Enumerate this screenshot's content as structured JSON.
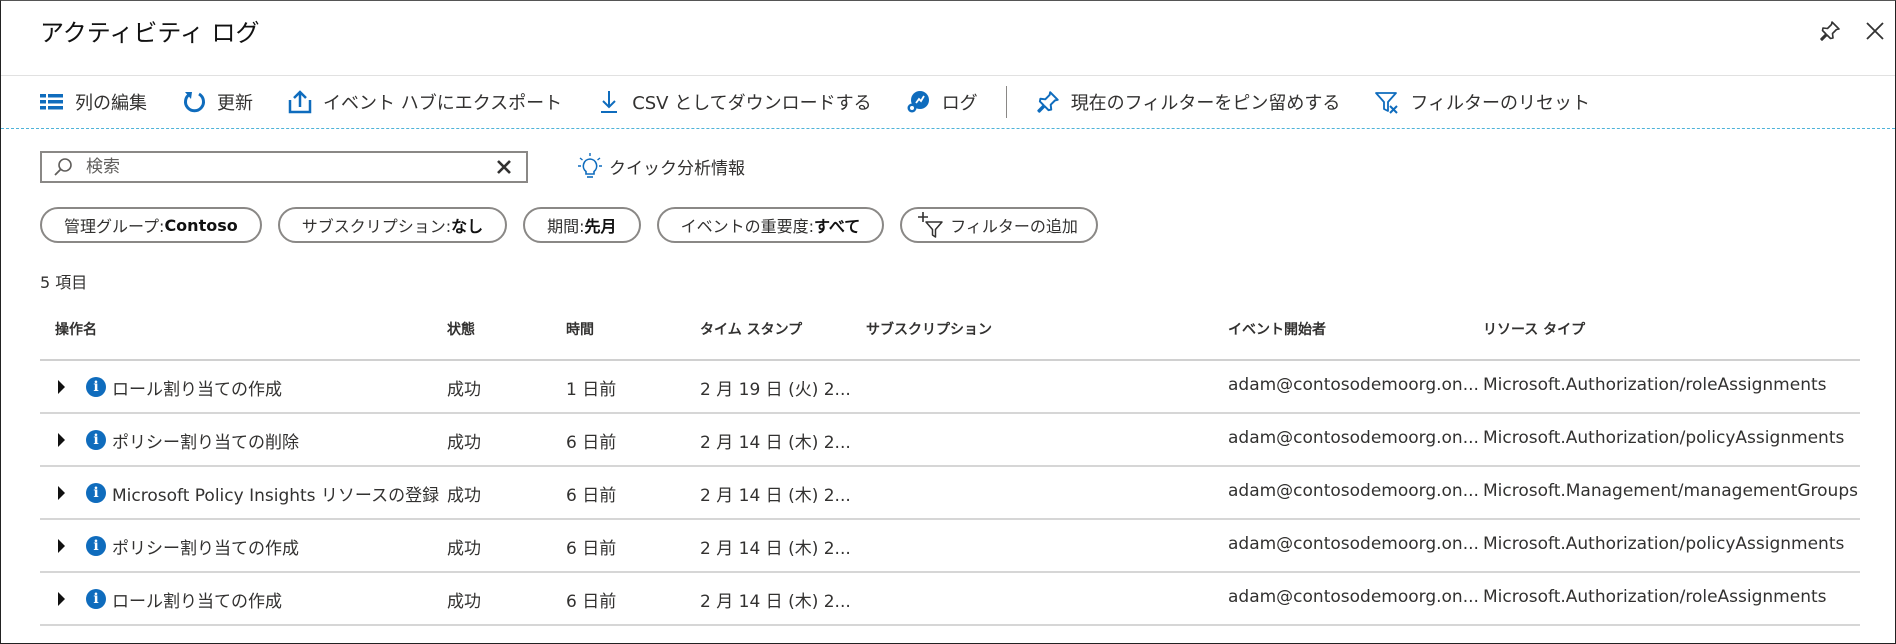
{
  "header": {
    "title": "アクティビティ ログ",
    "pin_icon": "pin-icon",
    "close_icon": "close-icon"
  },
  "toolbar": {
    "items": [
      {
        "label": "列の編集",
        "icon": "columns-icon"
      },
      {
        "label": "更新",
        "icon": "refresh-icon"
      },
      {
        "label": "イベント ハブにエクスポート",
        "icon": "export-icon"
      },
      {
        "label": "CSV としてダウンロードする",
        "icon": "download-icon"
      },
      {
        "label": "ログ",
        "icon": "logs-icon"
      },
      {
        "label": "現在のフィルターをピン留めする",
        "icon": "pin-icon"
      },
      {
        "label": "フィルターのリセット",
        "icon": "filter-reset-icon"
      }
    ]
  },
  "search": {
    "placeholder": "検索",
    "value": ""
  },
  "quick_insights": {
    "label": "クイック分析情報",
    "icon": "lightbulb-icon"
  },
  "filters": [
    {
      "name": "管理グループ: ",
      "value": "Contoso"
    },
    {
      "name": "サブスクリプション:",
      "value": "なし"
    },
    {
      "name": "期間:",
      "value": "先月"
    },
    {
      "name": "イベントの重要度:",
      "value": "すべて"
    }
  ],
  "add_filter": {
    "label": "フィルターの追加",
    "icon": "add-filter-icon"
  },
  "item_count": "5 項目",
  "table": {
    "columns": [
      "操作名",
      "状態",
      "時間",
      "タイム スタンプ",
      "サブスクリプション",
      "イベント開始者",
      "リソース タイプ"
    ],
    "rows": [
      {
        "operation": "ロール割り当ての作成",
        "status": "成功",
        "time": "1 日前",
        "timestamp": "2 月 19 日 (火) 2...",
        "subscription": "",
        "caller": "adam@contosodemoorg.on...",
        "resource_type": "Microsoft.Authorization/roleAssignments"
      },
      {
        "operation": "ポリシー割り当ての削除",
        "status": "成功",
        "time": "6 日前",
        "timestamp": "2 月 14 日 (木) 2...",
        "subscription": "",
        "caller": "adam@contosodemoorg.on...",
        "resource_type": "Microsoft.Authorization/policyAssignments"
      },
      {
        "operation": "Microsoft Policy Insights リソースの登録",
        "status": "成功",
        "time": "6 日前",
        "timestamp": "2 月 14 日 (木) 2...",
        "subscription": "",
        "caller": "adam@contosodemoorg.on...",
        "resource_type": "Microsoft.Management/managementGroups"
      },
      {
        "operation": "ポリシー割り当ての作成",
        "status": "成功",
        "time": "6 日前",
        "timestamp": "2 月 14 日 (木) 2...",
        "subscription": "",
        "caller": "adam@contosodemoorg.on...",
        "resource_type": "Microsoft.Authorization/policyAssignments"
      },
      {
        "operation": "ロール割り当ての作成",
        "status": "成功",
        "time": "6 日前",
        "timestamp": "2 月 14 日 (木) 2...",
        "subscription": "",
        "caller": "adam@contosodemoorg.on...",
        "resource_type": "Microsoft.Authorization/roleAssignments"
      }
    ]
  },
  "colors": {
    "accent": "#0f6cbd",
    "separator_dashed": "#4fb3d9"
  }
}
